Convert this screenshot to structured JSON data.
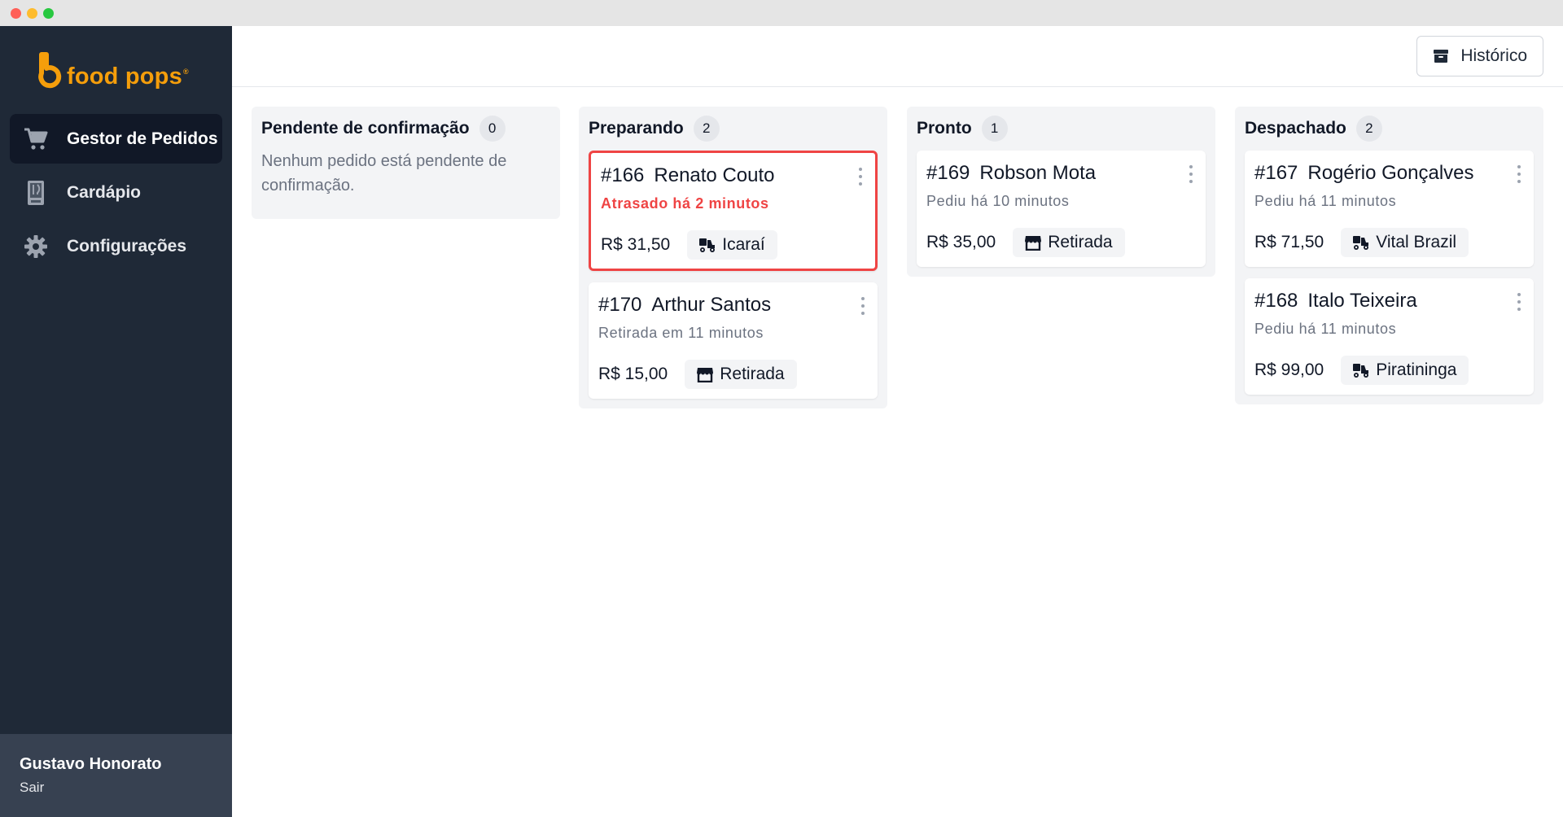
{
  "app": {
    "logo_text": "food pops",
    "logo_reg": "®"
  },
  "sidebar": {
    "items": [
      {
        "label": "Gestor de Pedidos",
        "icon": "cart-icon",
        "active": true
      },
      {
        "label": "Cardápio",
        "icon": "menu-book-icon",
        "active": false
      },
      {
        "label": "Configurações",
        "icon": "gear-icon",
        "active": false
      }
    ],
    "user": {
      "name": "Gustavo Honorato",
      "logout_label": "Sair"
    }
  },
  "topbar": {
    "history_label": "Histórico",
    "history_icon": "archive-icon"
  },
  "columns": [
    {
      "title": "Pendente de confirmação",
      "count": "0",
      "empty_text": "Nenhum pedido está pendente de confirmação.",
      "orders": []
    },
    {
      "title": "Preparando",
      "count": "2",
      "orders": [
        {
          "number": "#166",
          "customer": "Renato Couto",
          "status": "Atrasado há 2 minutos",
          "late": true,
          "price": "R$ 31,50",
          "tag": "Icaraí",
          "tag_icon": "delivery-scooter-icon"
        },
        {
          "number": "#170",
          "customer": "Arthur Santos",
          "status": "Retirada em 11 minutos",
          "late": false,
          "price": "R$ 15,00",
          "tag": "Retirada",
          "tag_icon": "store-icon"
        }
      ]
    },
    {
      "title": "Pronto",
      "count": "1",
      "orders": [
        {
          "number": "#169",
          "customer": "Robson Mota",
          "status": "Pediu há 10 minutos",
          "late": false,
          "price": "R$ 35,00",
          "tag": "Retirada",
          "tag_icon": "store-icon"
        }
      ]
    },
    {
      "title": "Despachado",
      "count": "2",
      "orders": [
        {
          "number": "#167",
          "customer": "Rogério Gonçalves",
          "status": "Pediu há 11 minutos",
          "late": false,
          "price": "R$ 71,50",
          "tag": "Vital Brazil",
          "tag_icon": "delivery-scooter-icon"
        },
        {
          "number": "#168",
          "customer": "Italo Teixeira",
          "status": "Pediu há 11 minutos",
          "late": false,
          "price": "R$ 99,00",
          "tag": "Piratininga",
          "tag_icon": "delivery-scooter-icon"
        }
      ]
    }
  ],
  "colors": {
    "sidebar_bg": "#1f2937",
    "sidebar_active": "#111827",
    "brand": "#f59e0b",
    "late": "#ef4444",
    "column_bg": "#f3f4f6"
  }
}
